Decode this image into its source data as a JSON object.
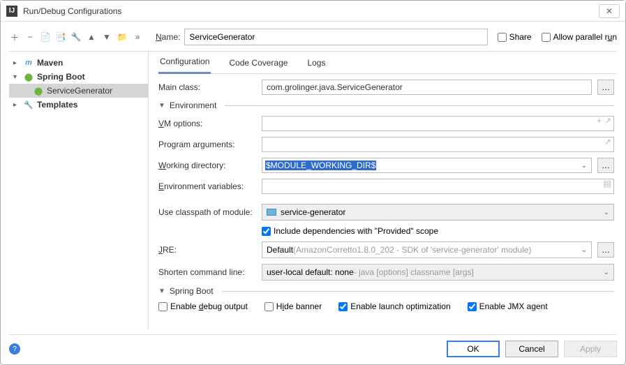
{
  "window": {
    "title": "Run/Debug Configurations"
  },
  "toolbar": {
    "name_label": "Name:",
    "name_value": "ServiceGenerator",
    "share_label": "Share",
    "parallel_label": "Allow parallel run"
  },
  "tree": {
    "maven": "Maven",
    "spring_boot": "Spring Boot",
    "service_generator": "ServiceGenerator",
    "templates": "Templates"
  },
  "tabs": {
    "configuration": "Configuration",
    "code_coverage": "Code Coverage",
    "logs": "Logs"
  },
  "form": {
    "main_class_label": "Main class:",
    "main_class_value": "com.grolinger.java.ServiceGenerator",
    "env_header": "Environment",
    "vm_label": "VM options:",
    "prog_args_label": "Program arguments:",
    "work_dir_label": "Working directory:",
    "work_dir_value": "$MODULE_WORKING_DIR$",
    "env_vars_label": "Environment variables:",
    "classpath_label": "Use classpath of module:",
    "classpath_value": "service-generator",
    "include_deps_label": "Include dependencies with \"Provided\" scope",
    "jre_label": "JRE:",
    "jre_value_prefix": "Default ",
    "jre_value_gray": "(AmazonCorretto1.8.0_202 - SDK of 'service-generator' module)",
    "shorten_label": "Shorten command line:",
    "shorten_value_prefix": "user-local default: none ",
    "shorten_value_gray": "- java [options] classname [args]",
    "spring_header": "Spring Boot",
    "enable_debug": "Enable debug output",
    "hide_banner": "Hide banner",
    "enable_launch": "Enable launch optimization",
    "enable_jmx": "Enable JMX agent"
  },
  "footer": {
    "ok": "OK",
    "cancel": "Cancel",
    "apply": "Apply"
  }
}
